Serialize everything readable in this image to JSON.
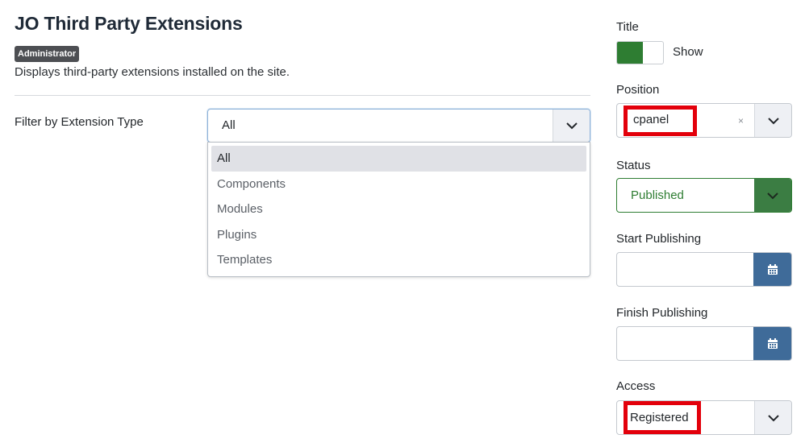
{
  "header": {
    "title": "JO Third Party Extensions",
    "badge": "Administrator",
    "description": "Displays third-party extensions installed on the site."
  },
  "filter": {
    "label": "Filter by Extension Type",
    "selected": "All",
    "options": [
      "All",
      "Components",
      "Modules",
      "Plugins",
      "Templates"
    ]
  },
  "sidebar": {
    "title_label": "Title",
    "title_toggle_text": "Show",
    "position_label": "Position",
    "position_value": "cpanel",
    "position_clear": "×",
    "status_label": "Status",
    "status_value": "Published",
    "start_label": "Start Publishing",
    "start_value": "",
    "finish_label": "Finish Publishing",
    "finish_value": "",
    "access_label": "Access",
    "access_value": "Registered"
  },
  "colors": {
    "accent_green": "#2e7d32",
    "calendar_button": "#3f6b99",
    "highlight_red": "#e3000b"
  },
  "icons": {
    "dropdown": "chevron-down-icon",
    "calendar": "calendar-icon",
    "clear": "clear-icon"
  }
}
